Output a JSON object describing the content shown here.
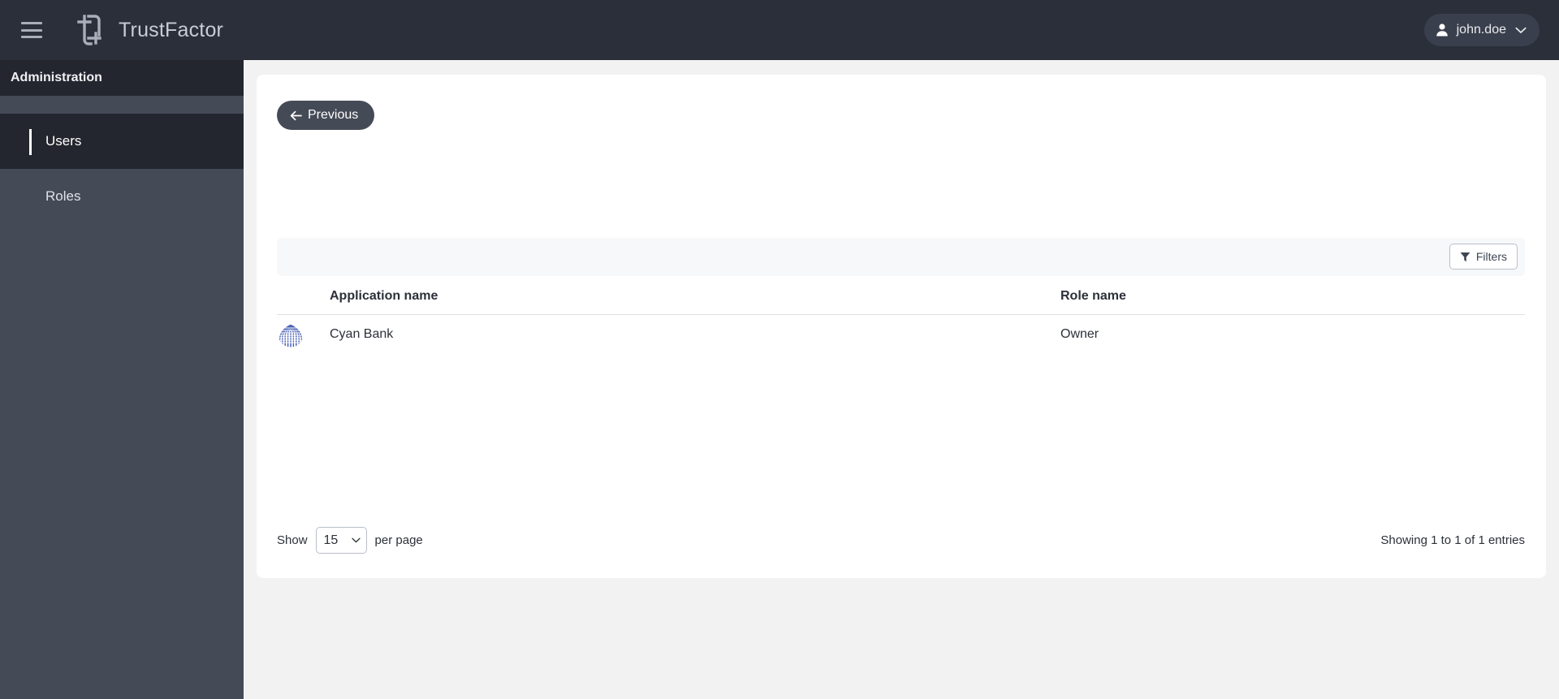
{
  "topbar": {
    "menu_icon": "hamburger-icon",
    "logo_icon": "trustfactor-logo-icon",
    "brand_name": "TrustFactor",
    "user": {
      "avatar_icon": "user-avatar-icon",
      "name": "john.doe",
      "chevron_icon": "chevron-down-icon"
    }
  },
  "sidebar": {
    "header": "Administration",
    "items": [
      {
        "label": "Users",
        "active": true
      },
      {
        "label": "Roles",
        "active": false
      }
    ]
  },
  "main": {
    "previous_button": {
      "label": "Previous",
      "icon": "arrow-left-icon"
    },
    "toolbar": {
      "filters_button": {
        "label": "Filters",
        "icon": "funnel-icon"
      }
    },
    "table": {
      "columns": [
        "Application name",
        "Role name"
      ],
      "rows": [
        {
          "logo_icon": "cyan-bank-logo-icon",
          "application_name": "Cyan Bank",
          "role_name": "Owner"
        }
      ]
    },
    "footer": {
      "show_label": "Show",
      "page_size_value": "15",
      "page_size_options": [
        "15"
      ],
      "per_page_label": "per page",
      "entries_info": "Showing 1 to 1 of 1 entries"
    }
  },
  "colors": {
    "topbar_bg": "#2b2f3a",
    "sidebar_bg": "#454a57",
    "sidebar_active_bg": "#23262f",
    "page_bg": "#f2f2f2",
    "card_bg": "#ffffff",
    "toolbar_bg": "#f7f8fa",
    "text_primary": "#2c3038",
    "accent_logo": "#4a62b5"
  }
}
